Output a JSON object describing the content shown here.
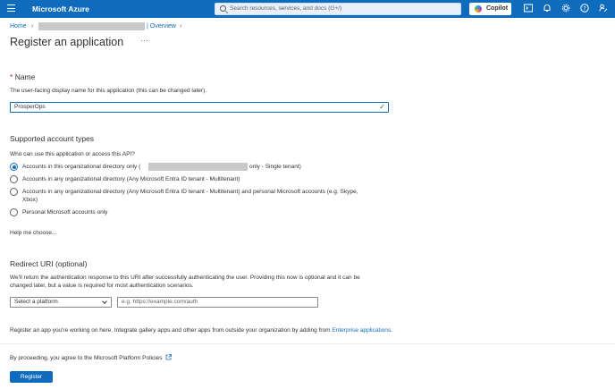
{
  "topbar": {
    "brand": "Microsoft Azure",
    "search_placeholder": "Search resources, services, and docs (G+/)",
    "copilot_label": "Copilot"
  },
  "breadcrumb": {
    "home": "Home",
    "overview": "| Overview"
  },
  "page": {
    "title": "Register an application",
    "more": "···"
  },
  "name_section": {
    "required_mark": "*",
    "label": "Name",
    "description": "The user-facing display name for this application (this can be changed later).",
    "value": "ProsperOps"
  },
  "account_types": {
    "heading": "Supported account types",
    "question": "Who can use this application or access this API?",
    "options": [
      {
        "label_prefix": "Accounts in this organizational directory only (",
        "label_suffix": "only - Single tenant)",
        "selected": true
      },
      {
        "label": "Accounts in any organizational directory (Any Microsoft Entra ID tenant - Multitenant)",
        "selected": false
      },
      {
        "label_line1": "Accounts in any organizational directory (Any Microsoft Entra ID tenant - Multitenant) and personal Microsoft accounts (e.g. Skype,",
        "label_line2": "Xbox)",
        "selected": false
      },
      {
        "label": "Personal Microsoft accounts only",
        "selected": false
      }
    ],
    "help_link": "Help me choose..."
  },
  "redirect": {
    "heading": "Redirect URI (optional)",
    "description_line1": "We'll return the authentication response to this URI after successfully authenticating the user. Providing this now is optional and it can be",
    "description_line2": "changed later, but a value is required for most authentication scenarios.",
    "platform_selected": "Select a platform",
    "uri_placeholder": "e.g. https://example.com/auth"
  },
  "register_note": {
    "text": "Register an app you're working on here. Integrate gallery apps and other apps from outside your organization by adding from",
    "link": "Enterprise applications",
    "end": "."
  },
  "footer": {
    "policy_link": "By proceeding, you agree to the Microsoft Platform Policies",
    "register_button": "Register"
  },
  "colors": {
    "accent": "#0f6cbd",
    "success": "#107c10",
    "required": "#a4262c"
  }
}
